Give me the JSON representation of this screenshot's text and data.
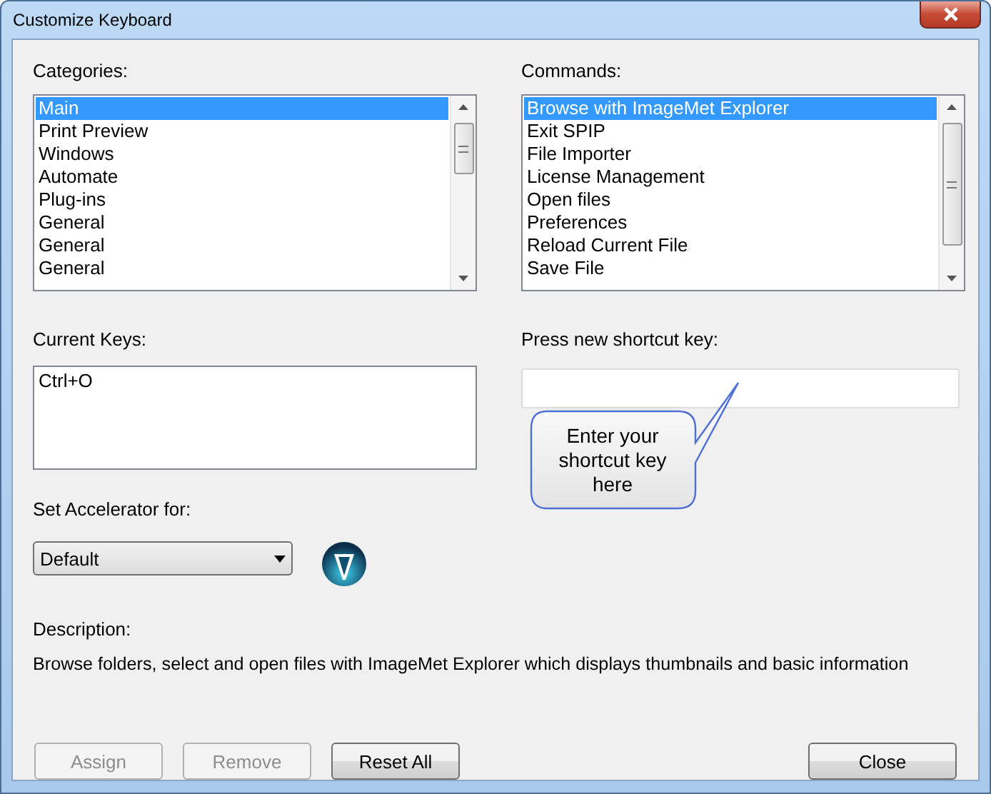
{
  "window": {
    "title": "Customize Keyboard"
  },
  "categories": {
    "label": "Categories:",
    "items": [
      {
        "label": "Main",
        "selected": true
      },
      {
        "label": "Print Preview",
        "selected": false
      },
      {
        "label": "Windows",
        "selected": false
      },
      {
        "label": "Automate",
        "selected": false
      },
      {
        "label": "Plug-ins",
        "selected": false
      },
      {
        "label": "General",
        "selected": false
      },
      {
        "label": "General",
        "selected": false
      },
      {
        "label": "General",
        "selected": false
      }
    ]
  },
  "commands": {
    "label": "Commands:",
    "items": [
      {
        "label": "Browse with ImageMet Explorer",
        "selected": true
      },
      {
        "label": "Exit SPIP",
        "selected": false
      },
      {
        "label": "File Importer",
        "selected": false
      },
      {
        "label": "License Management",
        "selected": false
      },
      {
        "label": "Open files",
        "selected": false
      },
      {
        "label": "Preferences",
        "selected": false
      },
      {
        "label": "Reload Current File",
        "selected": false
      },
      {
        "label": "Save File",
        "selected": false
      }
    ]
  },
  "current_keys": {
    "label": "Current Keys:",
    "items": [
      "Ctrl+O"
    ]
  },
  "shortcut": {
    "label": "Press new shortcut key:",
    "tooltip": "Enter your shortcut key here"
  },
  "accelerator": {
    "label": "Set Accelerator for:",
    "value": "Default"
  },
  "description": {
    "label": "Description:",
    "text": "Browse folders, select and open files with ImageMet Explorer which displays thumbnails and basic information"
  },
  "buttons": [
    {
      "label": "Assign",
      "disabled": true
    },
    {
      "label": "Remove",
      "disabled": true
    },
    {
      "label": "Reset All",
      "disabled": false
    }
  ],
  "close_button": {
    "label": "Close",
    "disabled": false
  }
}
